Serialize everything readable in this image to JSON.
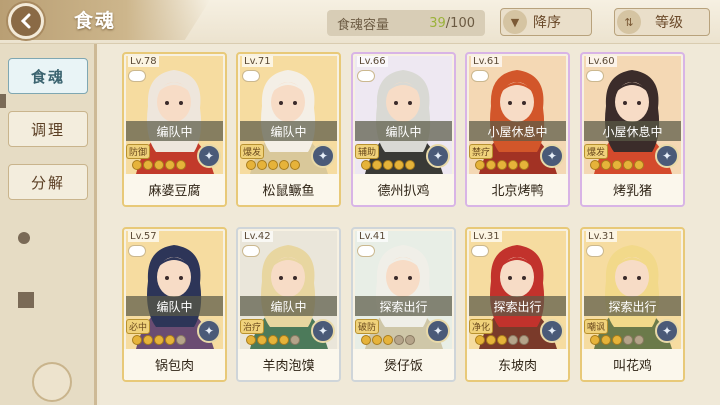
{
  "header": {
    "title": "食魂",
    "capacity_label": "食魂容量",
    "capacity_current": "39",
    "capacity_max": "/100",
    "sort_order_label": "降序",
    "sort_by_label": "等级"
  },
  "sidebar": {
    "tabs": [
      {
        "label": "食魂",
        "active": true
      },
      {
        "label": "调理",
        "active": false
      },
      {
        "label": "分解",
        "active": false
      }
    ]
  },
  "cards": [
    {
      "level": "Lv.78",
      "status": "编队中",
      "role": "防御",
      "name": "麻婆豆腐",
      "stars": 5,
      "frame": "gold",
      "hair": "#eee6dc",
      "outfit": "#c23a2a",
      "bg": "#f6dca0"
    },
    {
      "level": "Lv.71",
      "status": "编队中",
      "role": "爆发",
      "name": "松鼠鳜鱼",
      "stars": 5,
      "frame": "gold",
      "hair": "#f4efe6",
      "outfit": "#d9c89a",
      "bg": "#f6dca0"
    },
    {
      "level": "Lv.66",
      "status": "编队中",
      "role": "辅助",
      "name": "德州扒鸡",
      "stars": 5,
      "frame": "rainbow",
      "hair": "#d9d9d4",
      "outfit": "#3a3a36",
      "bg": "#eee8f2"
    },
    {
      "level": "Lv.61",
      "status": "小屋休息中",
      "role": "禁疗",
      "name": "北京烤鸭",
      "stars": 5,
      "frame": "rainbow",
      "hair": "#d2562a",
      "outfit": "#a23224",
      "bg": "#f4d8b4"
    },
    {
      "level": "Lv.60",
      "status": "小屋休息中",
      "role": "爆发",
      "name": "烤乳猪",
      "stars": 5,
      "frame": "rainbow",
      "hair": "#3b2c2a",
      "outfit": "#d44a2c",
      "bg": "#f4d8b4"
    },
    {
      "level": "Lv.57",
      "status": "编队中",
      "role": "必中",
      "name": "锅包肉",
      "stars": 4,
      "frame": "gold",
      "hair": "#2d3558",
      "outfit": "#6a4c72",
      "bg": "#f6dca0"
    },
    {
      "level": "Lv.42",
      "status": "编队中",
      "role": "治疗",
      "name": "羊肉泡馍",
      "stars": 4,
      "frame": "silver",
      "hair": "#e8d6a0",
      "outfit": "#4c7a5a",
      "bg": "#eae6da"
    },
    {
      "level": "Lv.41",
      "status": "探索出行",
      "role": "破防",
      "name": "煲仔饭",
      "stars": 3,
      "frame": "silver",
      "hair": "#f0efe8",
      "outfit": "#cfc7a8",
      "bg": "#e8eee6"
    },
    {
      "level": "Lv.31",
      "status": "探索出行",
      "role": "净化",
      "name": "东坡肉",
      "stars": 3,
      "frame": "gold",
      "hair": "#c2322c",
      "outfit": "#7a3a2a",
      "bg": "#f6dca0"
    },
    {
      "level": "Lv.31",
      "status": "探索出行",
      "role": "嘲讽",
      "name": "叫花鸡",
      "stars": 3,
      "frame": "gold",
      "hair": "#f2d98a",
      "outfit": "#6b7a4a",
      "bg": "#f6dca0"
    }
  ],
  "colors": {
    "accent_capacity": "#9bb23a",
    "active_tab": "#e9f4f6",
    "status_overlay": "#5a5a46"
  },
  "icons": [
    "back-arrow-icon",
    "sort-arrows-icon",
    "sort-order-icon",
    "star-icon",
    "element-badge-icon"
  ]
}
